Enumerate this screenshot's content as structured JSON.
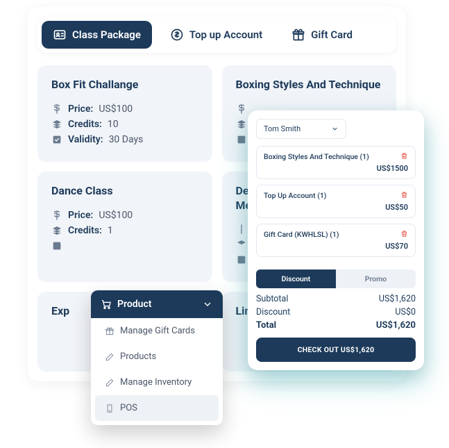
{
  "tabs": {
    "class_package": "Class Package",
    "top_up": "Top up Account",
    "gift_card": "Gift Card"
  },
  "products": {
    "p1": {
      "title": "Box Fit Challange",
      "price_label": "Price:",
      "price": "US$100",
      "credits_label": "Credits:",
      "credits": "10",
      "validity_label": "Validity:",
      "validity": "30 Days"
    },
    "p2": {
      "title": "Boxing Styles And Technique"
    },
    "p3": {
      "title": "Dance Class",
      "price_label": "Price:",
      "price": "US$100",
      "credits_label": "Credits:",
      "credits": "1"
    },
    "p4": {
      "title_partial": "Den",
      "title_partial2": "Mer"
    },
    "p5": {
      "title_partial": "Exp"
    },
    "p6": {
      "title_partial": "Lim"
    }
  },
  "dropdown": {
    "header": "Product",
    "items": {
      "gift": "Manage Gift Cards",
      "products": "Products",
      "inventory": "Manage Inventory",
      "pos": "POS"
    }
  },
  "cart": {
    "user": "Tom Smith",
    "items": {
      "i1": {
        "name": "Boxing Styles And Technique (1)",
        "price": "US$1500"
      },
      "i2": {
        "name": "Top Up Account (1)",
        "price": "US$50"
      },
      "i3": {
        "name": "Gift Card (KWHLSL) (1)",
        "price": "US$70"
      }
    },
    "seg": {
      "discount": "Discount",
      "promo": "Promo"
    },
    "subtotal_label": "Subtotal",
    "subtotal": "US$1,620",
    "discount_label": "Discount",
    "discount": "US$0",
    "total_label": "Total",
    "total": "US$1,620",
    "checkout": "CHECK OUT US$1,620"
  }
}
